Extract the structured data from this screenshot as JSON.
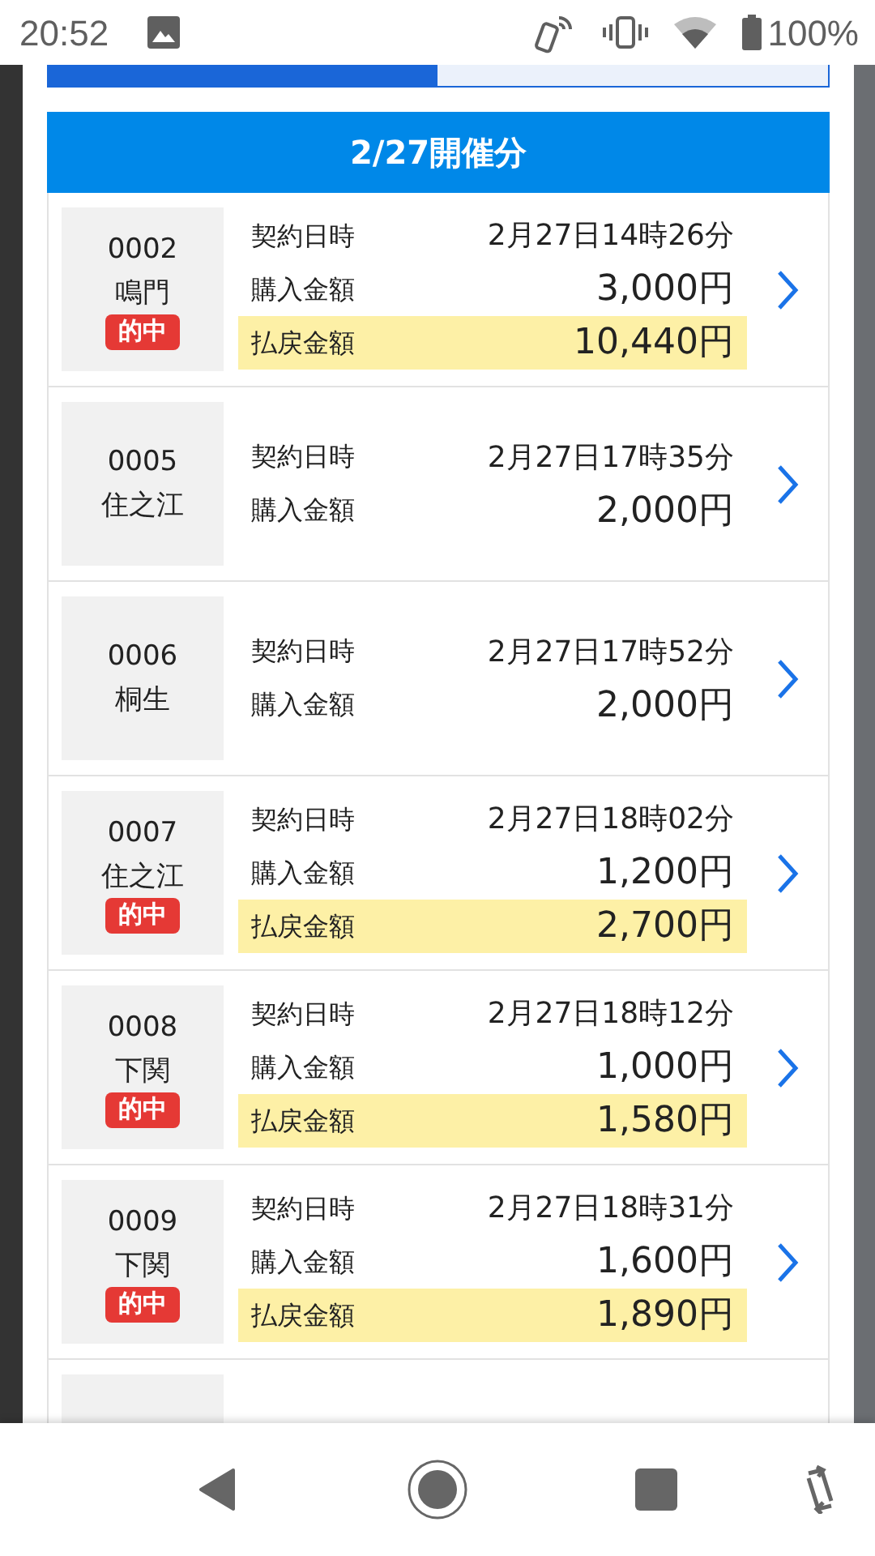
{
  "status_bar": {
    "time": "20:52",
    "battery": "100%"
  },
  "tabs": [
    {
      "selected": true
    },
    {
      "selected": false
    }
  ],
  "header": "2/27開催分",
  "entries": [
    {
      "number": "0002",
      "venue": "鳴門",
      "badge": "的中",
      "lines": [
        {
          "label": "契約日時",
          "value": "2月27日14時26分",
          "kind": "date"
        },
        {
          "label": "購入金額",
          "value": "3,000円",
          "kind": "amount"
        },
        {
          "label": "払戻金額",
          "value": "10,440円",
          "kind": "payout"
        }
      ]
    },
    {
      "number": "0005",
      "venue": "住之江",
      "lines": [
        {
          "label": "契約日時",
          "value": "2月27日17時35分",
          "kind": "date"
        },
        {
          "label": "購入金額",
          "value": "2,000円",
          "kind": "amount"
        }
      ]
    },
    {
      "number": "0006",
      "venue": "桐生",
      "lines": [
        {
          "label": "契約日時",
          "value": "2月27日17時52分",
          "kind": "date"
        },
        {
          "label": "購入金額",
          "value": "2,000円",
          "kind": "amount"
        }
      ]
    },
    {
      "number": "0007",
      "venue": "住之江",
      "badge": "的中",
      "lines": [
        {
          "label": "契約日時",
          "value": "2月27日18時02分",
          "kind": "date"
        },
        {
          "label": "購入金額",
          "value": "1,200円",
          "kind": "amount"
        },
        {
          "label": "払戻金額",
          "value": "2,700円",
          "kind": "payout"
        }
      ]
    },
    {
      "number": "0008",
      "venue": "下関",
      "badge": "的中",
      "lines": [
        {
          "label": "契約日時",
          "value": "2月27日18時12分",
          "kind": "date"
        },
        {
          "label": "購入金額",
          "value": "1,000円",
          "kind": "amount"
        },
        {
          "label": "払戻金額",
          "value": "1,580円",
          "kind": "payout"
        }
      ]
    },
    {
      "number": "0009",
      "venue": "下関",
      "badge": "的中",
      "lines": [
        {
          "label": "契約日時",
          "value": "2月27日18時31分",
          "kind": "date"
        },
        {
          "label": "購入金額",
          "value": "1,600円",
          "kind": "amount"
        },
        {
          "label": "払戻金額",
          "value": "1,890円",
          "kind": "payout"
        }
      ]
    }
  ]
}
